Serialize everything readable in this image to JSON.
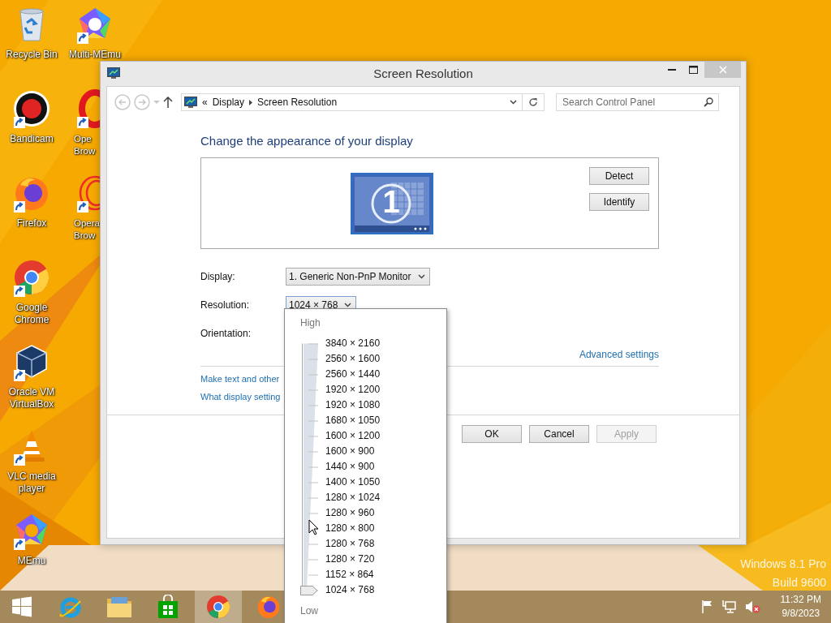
{
  "desktop": {
    "icons": [
      {
        "kind": "recycle-bin",
        "label": [
          "Recycle Bin"
        ],
        "shortcut": false
      },
      {
        "kind": "bandicam",
        "label": [
          "Bandicam"
        ],
        "shortcut": true
      },
      {
        "kind": "firefox",
        "label": [
          "Firefox"
        ],
        "shortcut": true
      },
      {
        "kind": "chrome",
        "label": [
          "Google",
          "Chrome"
        ],
        "shortcut": true
      },
      {
        "kind": "virtualbox",
        "label": [
          "Oracle VM",
          "VirtualBox"
        ],
        "shortcut": true
      },
      {
        "kind": "vlc",
        "label": [
          "VLC media",
          "player"
        ],
        "shortcut": true
      },
      {
        "kind": "memu",
        "label": [
          "MEmu"
        ],
        "shortcut": true
      },
      {
        "kind": "multi-memu",
        "label": [
          "Multi-MEmu"
        ],
        "shortcut": true
      },
      {
        "kind": "opera",
        "label": [
          "Ope",
          "Brow"
        ],
        "shortcut": true
      },
      {
        "kind": "opera-gx",
        "label": [
          "Opera",
          "Brow"
        ],
        "shortcut": true
      }
    ],
    "watermark": [
      "Windows 8.1 Pro",
      "Build 9600"
    ]
  },
  "window": {
    "title": "Screen Resolution",
    "nav": {
      "breadcrumb_prefix": "«",
      "breadcrumbs": [
        "Display",
        "Screen Resolution"
      ],
      "search": {
        "placeholder": "Search Control Panel"
      }
    },
    "heading": "Change the appearance of your display",
    "preview": {
      "monitor_number": "1",
      "buttons": [
        "Detect",
        "Identify"
      ]
    },
    "fields": [
      {
        "label": "Display:",
        "value": "1. Generic Non-PnP Monitor"
      },
      {
        "label": "Resolution:",
        "value": "1024 × 768",
        "expanded": true,
        "menu": {
          "high_label": "High",
          "low_label": "Low",
          "level": 0,
          "options": [
            "3840 × 2160",
            "2560 × 1600",
            "2560 × 1440",
            "1920 × 1200",
            "1920 × 1080",
            "1680 × 1050",
            "1600 × 1200",
            "1600 × 900",
            "1440 × 900",
            "1400 × 1050",
            "1280 × 1024",
            "1280 × 960",
            "1280 × 800",
            "1280 × 768",
            "1280 × 720",
            "1152 × 864",
            "1024 × 768"
          ]
        }
      },
      {
        "label": "Orientation:"
      }
    ],
    "advanced_link": "Advanced settings",
    "links": [
      "Make text and other",
      "What display setting"
    ],
    "buttons": [
      {
        "label": "OK",
        "disabled": false
      },
      {
        "label": "Cancel",
        "disabled": false
      },
      {
        "label": "Apply",
        "disabled": true
      }
    ]
  },
  "taskbar": {
    "apps": [
      {
        "kind": "start",
        "active": false
      },
      {
        "kind": "ie",
        "active": false
      },
      {
        "kind": "explorer",
        "active": false
      },
      {
        "kind": "store",
        "active": false
      },
      {
        "kind": "chrome",
        "active": true
      },
      {
        "kind": "firefox",
        "active": false
      }
    ],
    "tray": {
      "volume_muted": true,
      "time": "11:32 PM",
      "date": "9/8/2023"
    }
  }
}
